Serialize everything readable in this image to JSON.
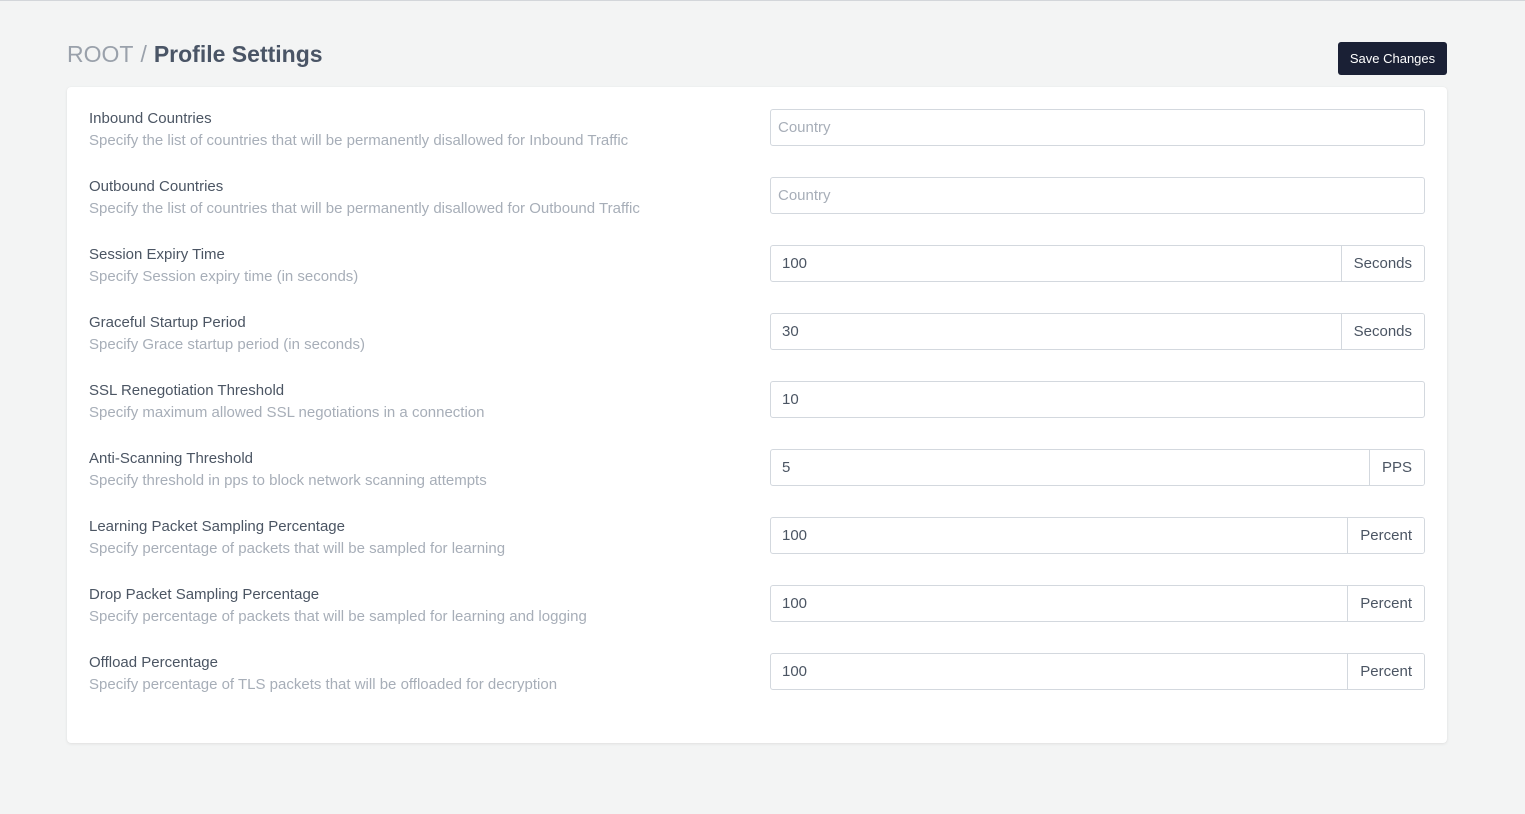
{
  "breadcrumb": {
    "root": "ROOT",
    "separator": "/",
    "current": "Profile Settings"
  },
  "actions": {
    "save_label": "Save Changes"
  },
  "settings": [
    {
      "label": "Inbound Countries",
      "description": "Specify the list of countries that will be permanently disallowed for Inbound Traffic",
      "value": "",
      "placeholder": "Country",
      "unit": ""
    },
    {
      "label": "Outbound Countries",
      "description": "Specify the list of countries that will be permanently disallowed for Outbound Traffic",
      "value": "",
      "placeholder": "Country",
      "unit": ""
    },
    {
      "label": "Session Expiry Time",
      "description": "Specify Session expiry time (in seconds)",
      "value": "100",
      "placeholder": "",
      "unit": "Seconds"
    },
    {
      "label": "Graceful Startup Period",
      "description": "Specify Grace startup period (in seconds)",
      "value": "30",
      "placeholder": "",
      "unit": "Seconds"
    },
    {
      "label": "SSL Renegotiation Threshold",
      "description": "Specify maximum allowed SSL negotiations in a connection",
      "value": "10",
      "placeholder": "",
      "unit": ""
    },
    {
      "label": "Anti-Scanning Threshold",
      "description": "Specify threshold in pps to block network scanning attempts",
      "value": "5",
      "placeholder": "",
      "unit": "PPS"
    },
    {
      "label": "Learning Packet Sampling Percentage",
      "description": "Specify percentage of packets that will be sampled for learning",
      "value": "100",
      "placeholder": "",
      "unit": "Percent"
    },
    {
      "label": "Drop Packet Sampling Percentage",
      "description": "Specify percentage of packets that will be sampled for learning and logging",
      "value": "100",
      "placeholder": "",
      "unit": "Percent"
    },
    {
      "label": "Offload Percentage",
      "description": "Specify percentage of TLS packets that will be offloaded for decryption",
      "value": "100",
      "placeholder": "",
      "unit": "Percent"
    }
  ]
}
